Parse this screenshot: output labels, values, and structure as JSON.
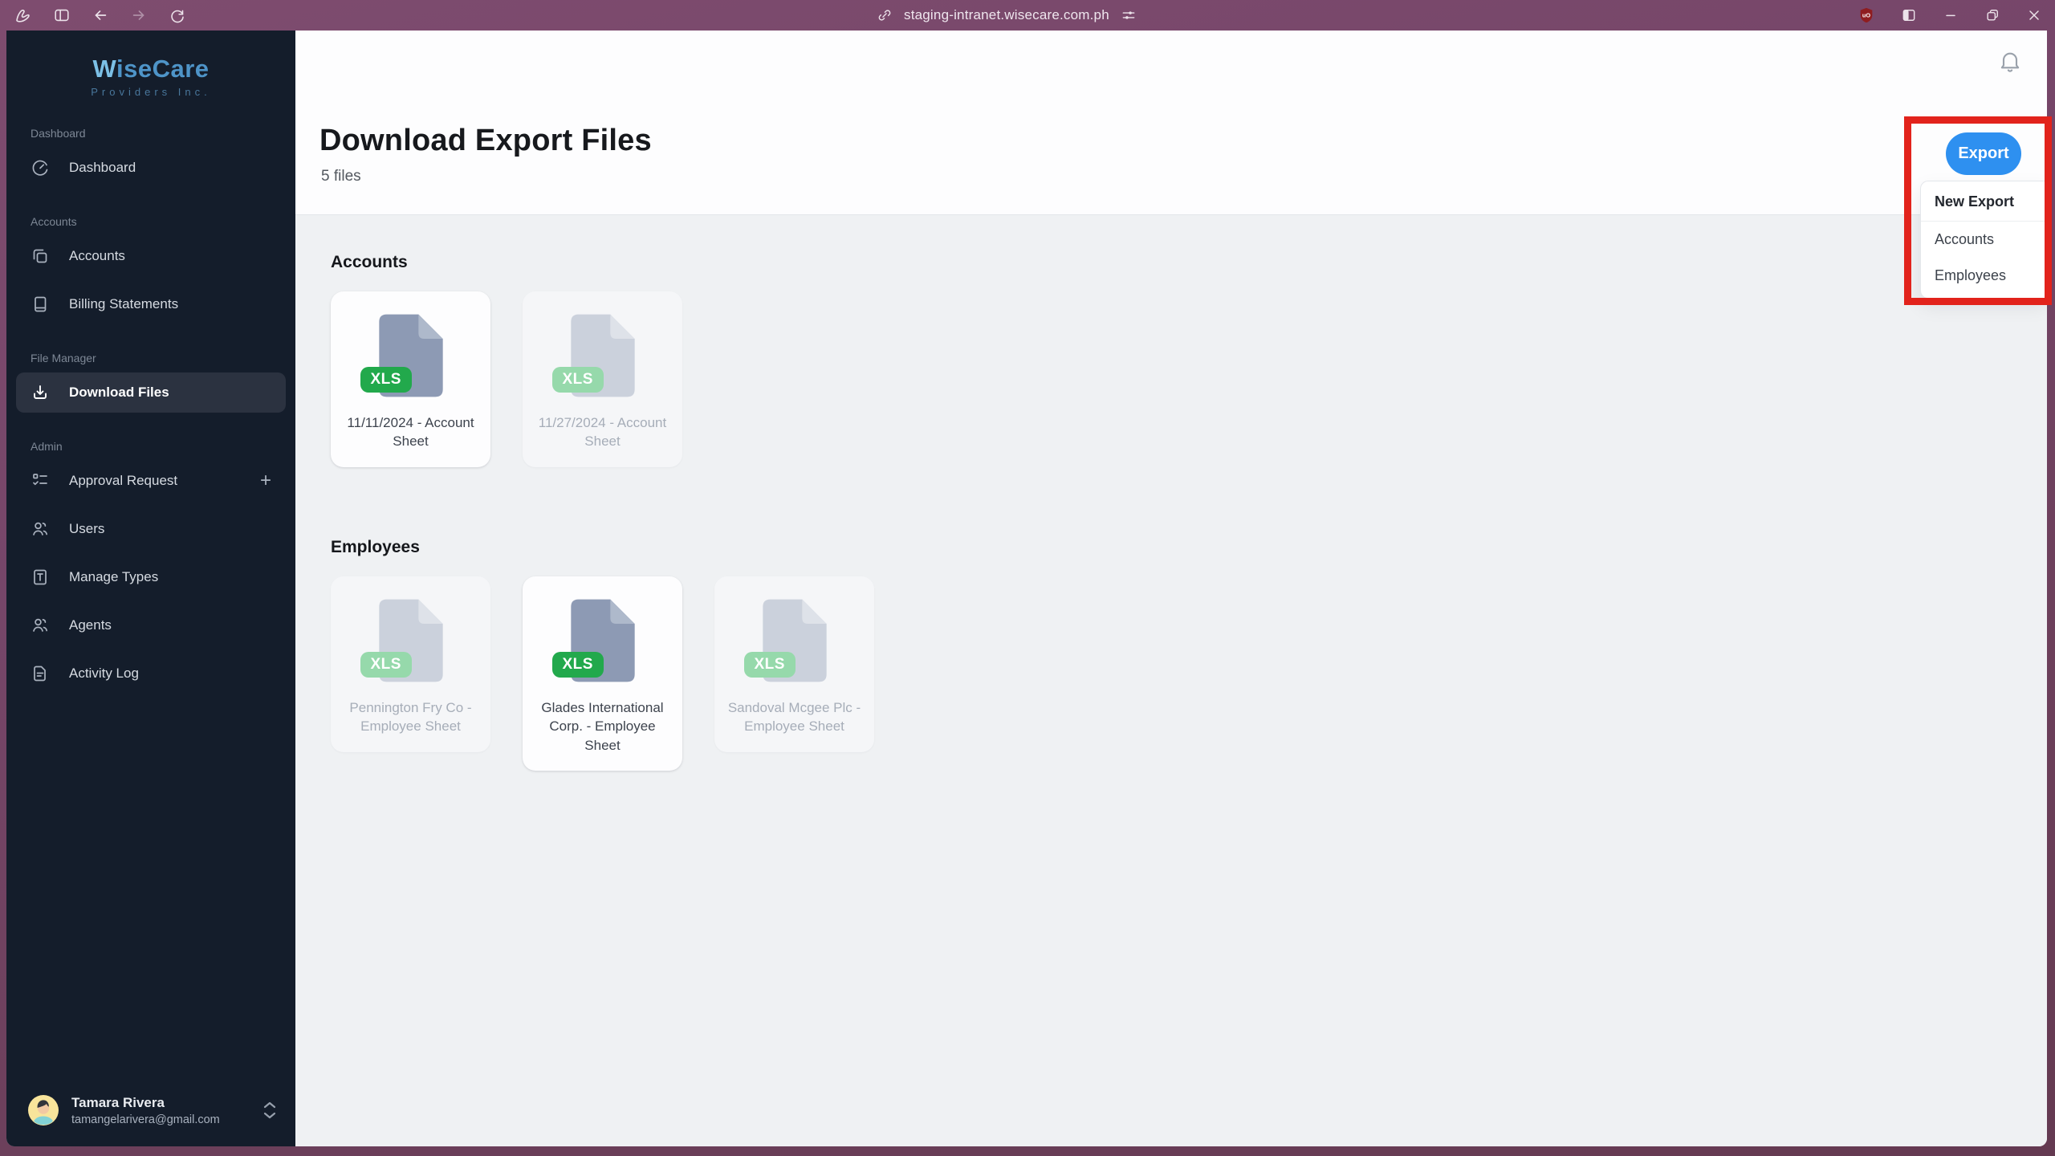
{
  "browser": {
    "url": "staging-intranet.wisecare.com.ph",
    "shield_badge": "uO"
  },
  "sidebar": {
    "logo": {
      "title": "WiseCare",
      "title_w": "W",
      "title_rest": "iseCare",
      "subtitle": "Providers Inc."
    },
    "sections": [
      {
        "label": "Dashboard",
        "items": [
          {
            "label": "Dashboard"
          }
        ]
      },
      {
        "label": "Accounts",
        "items": [
          {
            "label": "Accounts"
          },
          {
            "label": "Billing Statements"
          }
        ]
      },
      {
        "label": "File Manager",
        "items": [
          {
            "label": "Download Files"
          }
        ]
      },
      {
        "label": "Admin",
        "items": [
          {
            "label": "Approval Request",
            "trailing": "+"
          },
          {
            "label": "Users"
          },
          {
            "label": "Manage Types"
          },
          {
            "label": "Agents"
          },
          {
            "label": "Activity Log"
          }
        ]
      }
    ],
    "user": {
      "name": "Tamara Rivera",
      "email": "tamangelarivera@gmail.com"
    }
  },
  "header": {
    "title": "Download Export Files",
    "subtitle": "5 files",
    "export_button": "Export"
  },
  "export_menu": {
    "header": "New Export",
    "items": [
      "Accounts",
      "Employees"
    ]
  },
  "content": {
    "sections": [
      {
        "title": "Accounts",
        "files": [
          {
            "name": "11/11/2024 - Account Sheet",
            "badge": "XLS",
            "state": "active"
          },
          {
            "name": "11/27/2024 - Account Sheet",
            "badge": "XLS",
            "state": "disabled"
          }
        ]
      },
      {
        "title": "Employees",
        "files": [
          {
            "name": "Pennington Fry Co - Employee Sheet",
            "badge": "XLS",
            "state": "disabled"
          },
          {
            "name": "Glades International Corp. - Employee Sheet",
            "badge": "XLS",
            "state": "active"
          },
          {
            "name": "Sandoval Mcgee Plc - Employee Sheet",
            "badge": "XLS",
            "state": "disabled"
          }
        ]
      }
    ]
  },
  "colors": {
    "accent_blue": "#2e90f0",
    "badge_green": "#22a94c",
    "annotation_red": "#e2231c",
    "sidebar_bg": "#141d2b",
    "topbar_purple": "#7b4a6c"
  }
}
